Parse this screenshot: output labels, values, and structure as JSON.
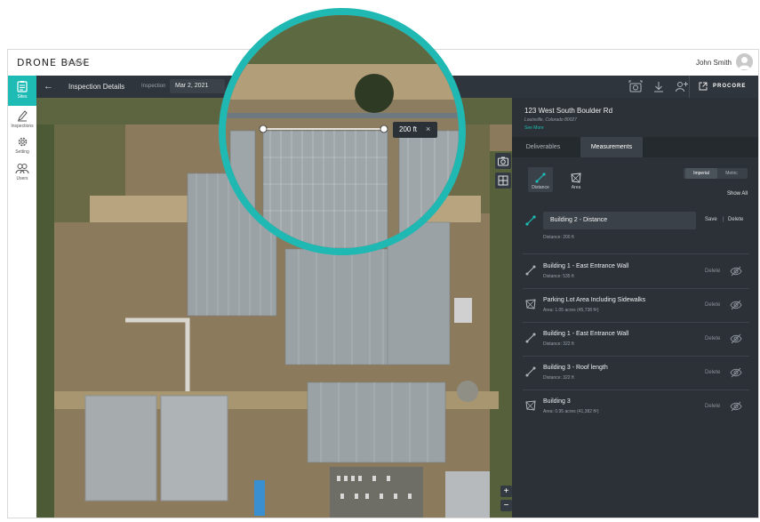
{
  "app": {
    "brand": "DRONE BASE",
    "brand_sub": "Insights",
    "user_name": "John Smith"
  },
  "rail": [
    {
      "label": "Sites",
      "icon": "clipboard-icon",
      "active": true
    },
    {
      "label": "Inspections",
      "icon": "pencil-icon",
      "active": false
    },
    {
      "label": "Setting",
      "icon": "gear-icon",
      "active": false
    },
    {
      "label": "Users",
      "icon": "users-icon",
      "active": false
    }
  ],
  "header": {
    "title": "Inspection Details",
    "inspection_label": "Inspection",
    "inspection_date": "Mar 2, 2021",
    "procore_label": "PROCORE"
  },
  "magnifier": {
    "measure_label": "200 ft",
    "close_glyph": "×"
  },
  "map_controls": {
    "zoom_in": "+",
    "zoom_out": "−"
  },
  "panel": {
    "address": "123 West South Boulder Rd",
    "address_sub": "Louisville, Colorado 80027",
    "see_more": "See More",
    "tabs": [
      {
        "label": "Deliverables",
        "active": false
      },
      {
        "label": "Measurements",
        "active": true
      }
    ],
    "tools": [
      {
        "label": "Distance",
        "active": true
      },
      {
        "label": "Area",
        "active": false
      }
    ],
    "units": [
      {
        "label": "Imperial",
        "active": true
      },
      {
        "label": "Metric",
        "active": false
      }
    ],
    "show_all": "Show All",
    "editing": {
      "value": "Building 2 - Distance",
      "sub": "Distance: 200 ft",
      "save": "Save",
      "separator": "|",
      "delete": "Delete"
    },
    "measurements": [
      {
        "title": "Building 1 - East Entrance Wall",
        "sub": "Distance: 535 ft",
        "type": "distance",
        "delete": "Delete"
      },
      {
        "title": "Parking Lot Area Including Sidewalks",
        "sub": "Area: 1.05 acres (45,738 ft²)",
        "type": "area",
        "delete": "Delete"
      },
      {
        "title": "Building 1 - East Entrance Wall",
        "sub": "Distance: 322 ft",
        "type": "distance",
        "delete": "Delete"
      },
      {
        "title": "Building 3 - Roof length",
        "sub": "Distance: 322 ft",
        "type": "distance",
        "delete": "Delete"
      },
      {
        "title": "Building 3",
        "sub": "Area: 0.95 acres (41,382 ft²)",
        "type": "area",
        "delete": "Delete"
      }
    ]
  },
  "colors": {
    "accent": "#1dbbb4",
    "panel_bg": "#2b3137",
    "header_bg": "#2f353c"
  }
}
